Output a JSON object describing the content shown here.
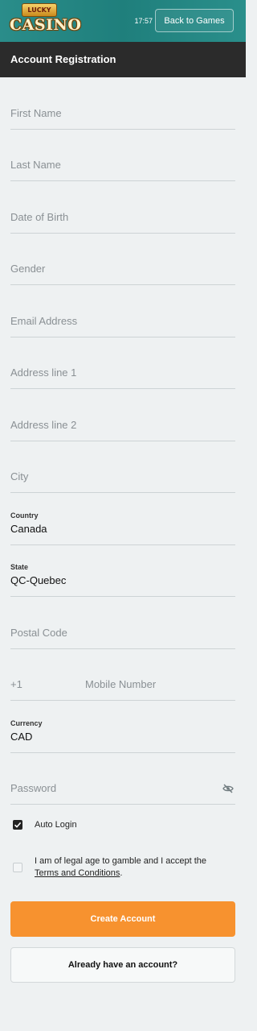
{
  "topbar": {
    "logo_top": "LUCKY",
    "logo_main": "CASINO",
    "time": "17:57",
    "back_label": "Back to Games"
  },
  "header": {
    "title": "Account Registration"
  },
  "form": {
    "first_name": {
      "placeholder": "First Name"
    },
    "last_name": {
      "placeholder": "Last Name"
    },
    "dob": {
      "placeholder": "Date of Birth"
    },
    "gender": {
      "placeholder": "Gender"
    },
    "email": {
      "placeholder": "Email Address"
    },
    "address1": {
      "placeholder": "Address line 1"
    },
    "address2": {
      "placeholder": "Address line 2"
    },
    "city": {
      "placeholder": "City"
    },
    "country": {
      "label": "Country",
      "value": "Canada"
    },
    "state": {
      "label": "State",
      "value": "QC-Quebec"
    },
    "postal": {
      "placeholder": "Postal Code"
    },
    "mobile": {
      "code": "+1",
      "placeholder": "Mobile Number"
    },
    "currency": {
      "label": "Currency",
      "value": "CAD"
    },
    "password": {
      "placeholder": "Password",
      "icon": "eye-slash-icon"
    }
  },
  "auto_login": {
    "label": "Auto Login",
    "checked": true
  },
  "terms": {
    "text": "I am of legal age to gamble and I accept the",
    "link": "Terms and Conditions",
    "suffix": ".",
    "checked": false
  },
  "buttons": {
    "create": "Create Account",
    "login": "Already have an account?"
  },
  "colors": {
    "topbar": "#1f7f7c",
    "header": "#2b2b2b",
    "accent": "#f7922f",
    "background": "#eef1f2"
  }
}
